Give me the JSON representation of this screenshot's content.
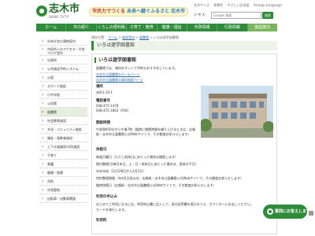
{
  "header": {
    "logo_text": "志木市",
    "logo_sub": "SHIKI CITY",
    "slogan_main": "市民力でつくる",
    "slogan_accent": "未来へ継ぐふるさと 志木市",
    "top_links": [
      "文字サイズ",
      "背景色",
      "やさしい日本語",
      "Foreign Language"
    ],
    "size_buttons": "小 中 大",
    "search_placeholder": "Google 検索",
    "search_button": "検索"
  },
  "nav": {
    "items": [
      "ホーム",
      "市の紹介",
      "くらしの便利帳",
      "子育て・教育",
      "健康・福祉",
      "市政情報",
      "行政情報",
      "施設案内"
    ],
    "active_index": 7
  },
  "breadcrumb": {
    "label": "現在位置",
    "items": [
      "ホーム",
      "施設案内",
      "図書館",
      "いろは遊学図書館"
    ]
  },
  "sidebar": {
    "items": [
      "市本庁舎の建物案内",
      "市役所へのアクセス・庁舎フロア案内",
      "出張所",
      "公共施設予約システム",
      "公園",
      "スポーツ施設",
      "小中学校",
      "公民館",
      "図書館",
      "社会教育施設",
      "文化・コミュニティ施設",
      "福祉・高齢者施設",
      "上下水道施設/水防施設",
      "子育て",
      "救護",
      "健康・医療",
      "消防",
      "市営墓地",
      "自転車・自動車関連"
    ],
    "active_index": 8
  },
  "content": {
    "page_title": "いろは遊学図書館",
    "panel_title": "いろは遊学図書館",
    "intro": "図書館では、資料をネットで予約もおすすめしています。",
    "links": [
      "志木市立図書館のホームページ",
      "志木市立図書館の資料検索ページ"
    ],
    "sections": [
      {
        "heading": "場所",
        "lines": [
          "本町1-10-1"
        ]
      },
      {
        "heading": "電話番号",
        "lines": [
          "048-471-1478",
          "048-471-1803（FAX）"
        ]
      },
      {
        "heading": "開館時間",
        "lines": [
          "午前9時30分から午後7時（臨時に閉館時間を繰り上げるときは、広報紙・志木市立図書館公式Webサイトで、その都度お知らせします）"
        ]
      },
      {
        "heading": "休館日",
        "lines": [
          "毎週月曜日（ただし祝休日にあたった場合は開館します）",
          "館内整理日(毎月末日、土・日・祝休日にあたった場合は、直前の平日)",
          "年末年始（12月28日から1月3日）",
          "特別整理期間（年内2日程以内、広報紙・志木市立図書館公式Webサイトで、その都度お知らせします）",
          "臨時休館日（広報紙・志木市立図書館公式Webサイトで、その都度お知らせします）"
        ]
      },
      {
        "heading": "利用の申込み",
        "lines": [
          "はじめてご利用になるには、利用申込書に記入して、身分証明書を提示のうえ、カウンターにお出しください。",
          "カードを発行します。"
        ]
      },
      {
        "heading": "利用料",
        "lines": []
      }
    ]
  },
  "fab": {
    "label": "質問にお答えします"
  },
  "colors": {
    "brand_green": "#2e8b3a",
    "nav_active": "#7ab55c",
    "link_blue": "#2e6da4"
  }
}
